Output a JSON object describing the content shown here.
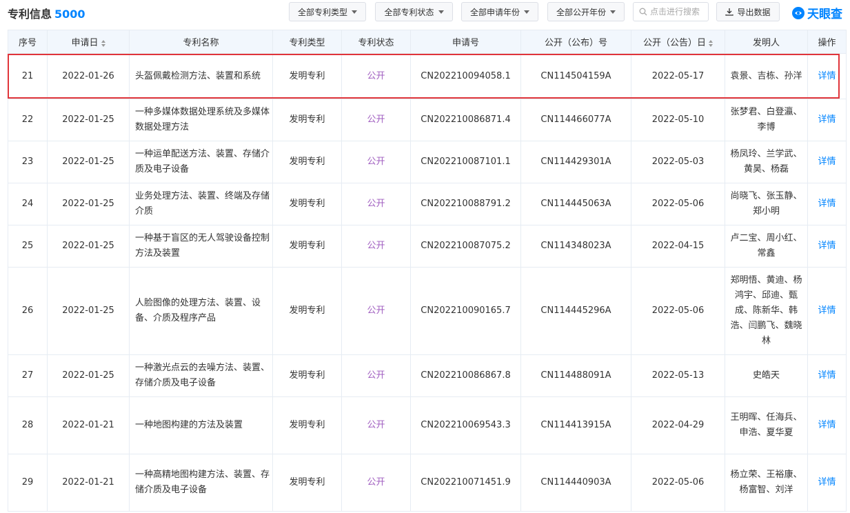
{
  "header": {
    "title": "专利信息",
    "count": "5000",
    "filters": [
      "全部专利类型",
      "全部专利状态",
      "全部申请年份",
      "全部公开年份"
    ],
    "search_placeholder": "点击进行搜索",
    "export_label": "导出数据",
    "logo_text": "天眼查"
  },
  "colors": {
    "accent": "#0084ff",
    "status": "#a05ec0",
    "highlight": "#e0343a",
    "header_bg": "#f2f7fd"
  },
  "table": {
    "columns": [
      "序号",
      "申请日",
      "专利名称",
      "专利类型",
      "专利状态",
      "申请号",
      "公开（公布）号",
      "公开（公告）日",
      "发明人",
      "操作"
    ],
    "rows": [
      {
        "no": "21",
        "date": "2022-01-26",
        "name": "头盔佩戴检测方法、装置和系统",
        "type": "发明专利",
        "status": "公开",
        "app_no": "CN202210094058.1",
        "pub_no": "CN114504159A",
        "pub_date": "2022-05-17",
        "inventors": "袁景、吉栋、孙洋",
        "action": "详情"
      },
      {
        "no": "22",
        "date": "2022-01-25",
        "name": "一种多媒体数据处理系统及多媒体数据处理方法",
        "type": "发明专利",
        "status": "公开",
        "app_no": "CN202210086871.4",
        "pub_no": "CN114466077A",
        "pub_date": "2022-05-10",
        "inventors": "张梦君、白登瀛、李博",
        "action": "详情"
      },
      {
        "no": "23",
        "date": "2022-01-25",
        "name": "一种运单配送方法、装置、存储介质及电子设备",
        "type": "发明专利",
        "status": "公开",
        "app_no": "CN202210087101.1",
        "pub_no": "CN114429301A",
        "pub_date": "2022-05-03",
        "inventors": "杨凤玲、兰学武、黄昊、杨磊",
        "action": "详情"
      },
      {
        "no": "24",
        "date": "2022-01-25",
        "name": "业务处理方法、装置、终端及存储介质",
        "type": "发明专利",
        "status": "公开",
        "app_no": "CN202210088791.2",
        "pub_no": "CN114445063A",
        "pub_date": "2022-05-06",
        "inventors": "尚晓飞、张玉静、郑小明",
        "action": "详情"
      },
      {
        "no": "25",
        "date": "2022-01-25",
        "name": "一种基于盲区的无人驾驶设备控制方法及装置",
        "type": "发明专利",
        "status": "公开",
        "app_no": "CN202210087075.2",
        "pub_no": "CN114348023A",
        "pub_date": "2022-04-15",
        "inventors": "卢二宝、周小红、常鑫",
        "action": "详情"
      },
      {
        "no": "26",
        "date": "2022-01-25",
        "name": "人脸图像的处理方法、装置、设备、介质及程序产品",
        "type": "发明专利",
        "status": "公开",
        "app_no": "CN202210090165.7",
        "pub_no": "CN114445296A",
        "pub_date": "2022-05-06",
        "inventors": "郑明悟、黄迪、杨鸿宇、邱迪、甄成、陈新华、韩浩、闫鹏飞、魏晓林",
        "action": "详情"
      },
      {
        "no": "27",
        "date": "2022-01-25",
        "name": "一种激光点云的去噪方法、装置、存储介质及电子设备",
        "type": "发明专利",
        "status": "公开",
        "app_no": "CN202210086867.8",
        "pub_no": "CN114488091A",
        "pub_date": "2022-05-13",
        "inventors": "史皓天",
        "action": "详情"
      },
      {
        "no": "28",
        "date": "2022-01-21",
        "name": "一种地图构建的方法及装置",
        "type": "发明专利",
        "status": "公开",
        "app_no": "CN202210069543.3",
        "pub_no": "CN114413915A",
        "pub_date": "2022-04-29",
        "inventors": "王明晖、任海兵、申浩、夏华夏",
        "action": "详情"
      },
      {
        "no": "29",
        "date": "2022-01-21",
        "name": "一种高精地图构建方法、装置、存储介质及电子设备",
        "type": "发明专利",
        "status": "公开",
        "app_no": "CN202210071451.9",
        "pub_no": "CN114440903A",
        "pub_date": "2022-05-06",
        "inventors": "杨立荣、王裕康、杨富智、刘洋",
        "action": "详情"
      }
    ]
  }
}
